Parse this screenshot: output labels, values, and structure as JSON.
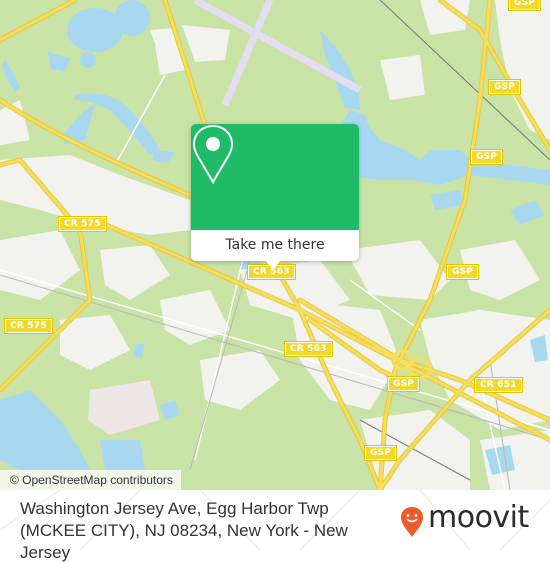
{
  "map": {
    "attribution": "© OpenStreetMap contributors",
    "colors": {
      "background": "#f2f2ee",
      "woodland": "#c9e3a6",
      "water": "#a8d8f0",
      "major_road": "#f5de5a",
      "road_casing": "#e8c840",
      "minor_road": "#ffffff",
      "runway": "#e4dcf0",
      "railway": "#777777",
      "industrial": "#ece6e6"
    },
    "road_shields": [
      {
        "id": "gsp-1",
        "label": "GSP"
      },
      {
        "id": "gsp-2",
        "label": "GSP"
      },
      {
        "id": "gsp-3",
        "label": "GSP"
      },
      {
        "id": "gsp-4",
        "label": "GSP"
      },
      {
        "id": "gsp-5",
        "label": "GSP"
      },
      {
        "id": "gsp-6",
        "label": "GSP"
      },
      {
        "id": "cr575-1",
        "label": "CR 575"
      },
      {
        "id": "cr575-2",
        "label": "CR 575"
      },
      {
        "id": "cr563-1",
        "label": "CR 563"
      },
      {
        "id": "cr563-2",
        "label": "CR 563"
      },
      {
        "id": "cr651-1",
        "label": "CR 651"
      }
    ]
  },
  "popup": {
    "icon": "location-pin-icon",
    "button_label": "Take me there",
    "color": "#1fbb68"
  },
  "footer": {
    "address": "Washington Jersey Ave, Egg Harbor Twp (MCKEE CITY), NJ 08234, New York - New Jersey",
    "brand": "moovit",
    "brand_icon": "moovit-smiley-pin-icon",
    "brand_color": "#f05a28"
  }
}
